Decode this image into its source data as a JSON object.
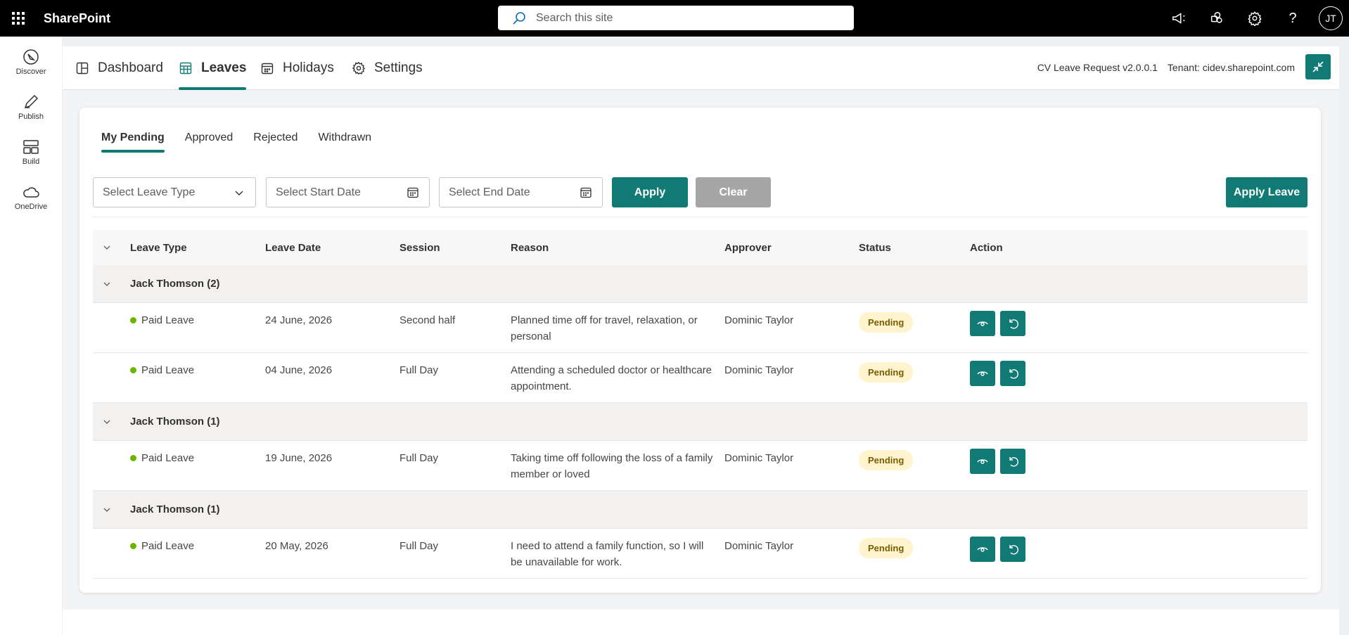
{
  "suite": {
    "brand": "SharePoint",
    "search_placeholder": "Search this site",
    "avatar_initials": "JT"
  },
  "appbar": {
    "items": [
      {
        "label": "Discover",
        "icon": "compass-icon"
      },
      {
        "label": "Publish",
        "icon": "pen-icon"
      },
      {
        "label": "Build",
        "icon": "layout-icon"
      },
      {
        "label": "OneDrive",
        "icon": "cloud-icon"
      }
    ]
  },
  "nav": {
    "tabs": [
      {
        "label": "Dashboard",
        "icon": "dashboard-icon"
      },
      {
        "label": "Leaves",
        "icon": "table-icon",
        "active": true
      },
      {
        "label": "Holidays",
        "icon": "calendar-icon"
      },
      {
        "label": "Settings",
        "icon": "gear-icon"
      }
    ],
    "version": "CV Leave Request v2.0.0.1",
    "tenant": "Tenant: cidev.sharepoint.com"
  },
  "subtabs": [
    "My Pending",
    "Approved",
    "Rejected",
    "Withdrawn"
  ],
  "filters": {
    "leave_type_placeholder": "Select Leave Type",
    "start_date_placeholder": "Select Start Date",
    "end_date_placeholder": "Select End Date",
    "apply": "Apply",
    "clear": "Clear",
    "apply_leave": "Apply Leave"
  },
  "table": {
    "columns": [
      "Leave Type",
      "Leave Date",
      "Session",
      "Reason",
      "Approver",
      "Status",
      "Action"
    ],
    "groups": [
      {
        "title": "Jack Thomson (2)",
        "rows": [
          {
            "type": "Paid Leave",
            "date": "24 June, 2026",
            "session": "Second half",
            "reason": "Planned time off for travel, relaxation, or personal",
            "approver": "Dominic Taylor",
            "status": "Pending"
          },
          {
            "type": "Paid Leave",
            "date": "04 June, 2026",
            "session": "Full Day",
            "reason": "Attending a scheduled doctor or healthcare appointment.",
            "approver": "Dominic Taylor",
            "status": "Pending"
          }
        ]
      },
      {
        "title": "Jack Thomson (1)",
        "rows": [
          {
            "type": "Paid Leave",
            "date": "19 June, 2026",
            "session": "Full Day",
            "reason": "Taking time off following the loss of a family member or loved",
            "approver": "Dominic Taylor",
            "status": "Pending"
          }
        ]
      },
      {
        "title": "Jack Thomson (1)",
        "rows": [
          {
            "type": "Paid Leave",
            "date": "20 May, 2026",
            "session": "Full Day",
            "reason": "I need to attend a family function, so I will be unavailable for work.",
            "approver": "Dominic Taylor",
            "status": "Pending"
          }
        ]
      }
    ]
  },
  "colors": {
    "accent": "#117a74",
    "pending_bg": "#fff4ce",
    "status_dot": "#6bb700"
  }
}
